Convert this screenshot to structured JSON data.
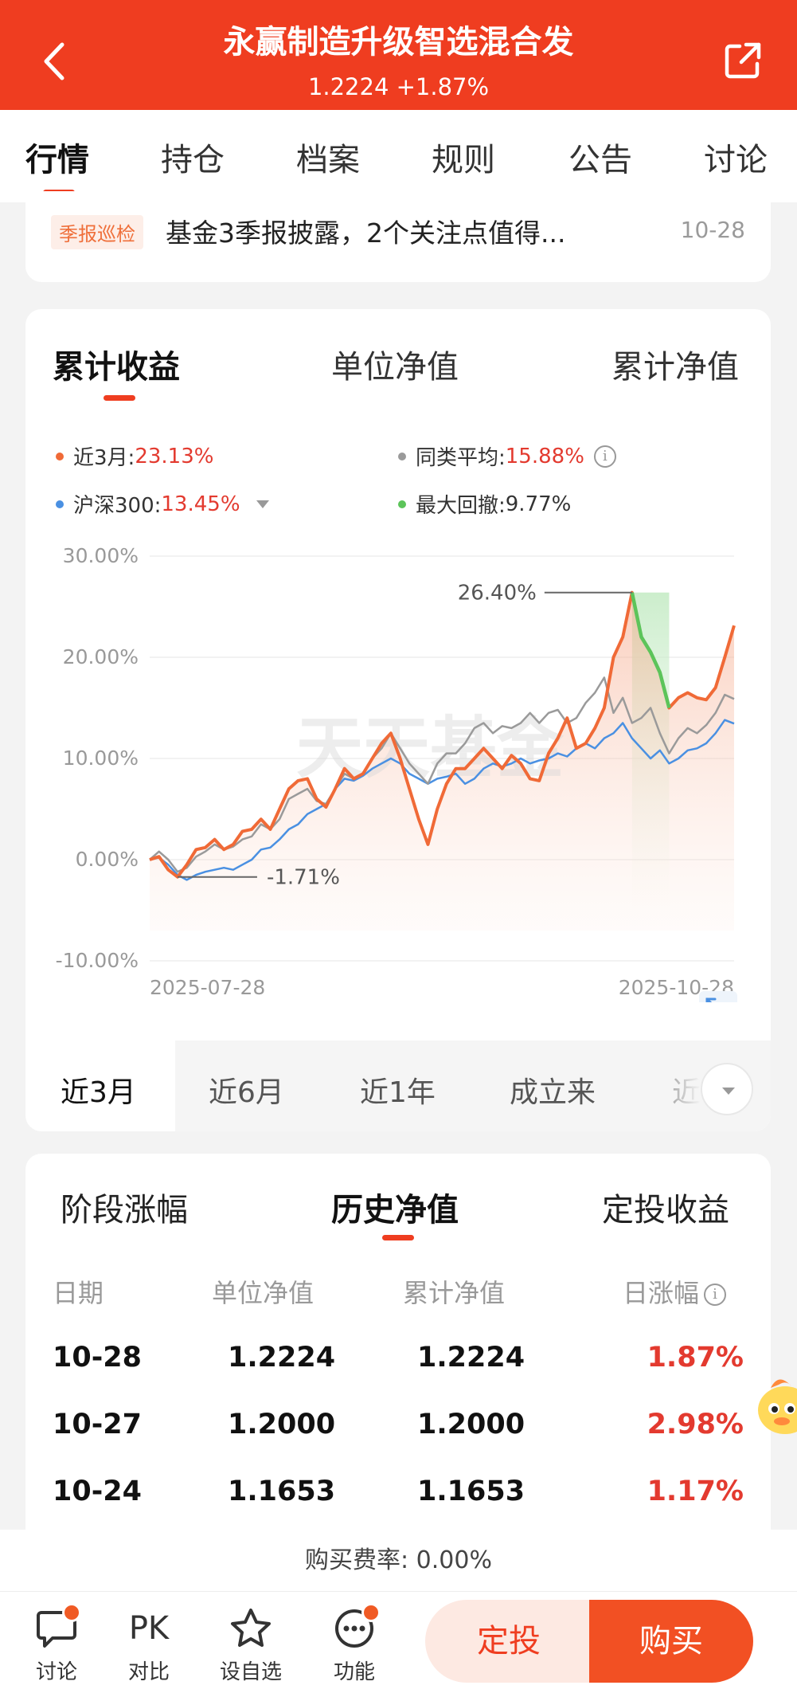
{
  "header": {
    "title": "永赢制造升级智选混合发",
    "nav_value": "1.2224 +1.87%"
  },
  "main_tabs": [
    "行情",
    "持仓",
    "档案",
    "规则",
    "公告",
    "讨论"
  ],
  "notice": {
    "tag": "季报巡检",
    "text": "基金3季报披露，2个关注点值得...",
    "date": "10-28"
  },
  "chart_tabs": [
    "累计收益",
    "单位净值",
    "累计净值"
  ],
  "legend": {
    "fund_label": "近3月:",
    "fund_value": "23.13%",
    "peer_label": "同类平均:",
    "peer_value": "15.88%",
    "index_label": "沪深300:",
    "index_value": "13.45%",
    "drawdown_label": "最大回撤:",
    "drawdown_value": "9.77%"
  },
  "watermark": "天天基金",
  "colors": {
    "accent": "#ef3d20",
    "fund": "#f06a37",
    "peer": "#9a9a9a",
    "index": "#4a90e2",
    "drawdown": "#5cc45a",
    "up": "#e33a2f"
  },
  "chart_data": {
    "type": "line",
    "ylim": [
      -10,
      30
    ],
    "yticks": [
      "30.00%",
      "20.00%",
      "10.00%",
      "0.00%",
      "-10.00%"
    ],
    "xticks": [
      "2025-07-28",
      "2025-10-28"
    ],
    "annotations": [
      "26.40%",
      "-1.71%"
    ],
    "series": [
      {
        "name": "近3月",
        "values": [
          0,
          0.3,
          -1,
          -1.71,
          -0.5,
          1,
          1.2,
          2,
          1,
          1.5,
          2.8,
          3,
          4,
          3,
          5,
          7,
          7.8,
          8,
          6,
          5.2,
          7,
          9,
          8,
          8.5,
          10,
          11.5,
          12.5,
          10,
          7,
          4,
          1.5,
          5,
          7.5,
          9,
          9,
          10,
          11,
          10,
          9,
          10.3,
          9.5,
          8,
          7.8,
          10.5,
          12,
          14,
          11,
          11.5,
          13,
          15,
          20,
          22,
          26.4,
          22,
          20.5,
          18.5,
          15,
          16,
          16.5,
          16,
          15.8,
          17,
          20,
          23.13
        ]
      },
      {
        "name": "同类平均",
        "values": [
          0,
          0.8,
          0,
          -1.2,
          -0.8,
          0.3,
          0.8,
          1.5,
          1,
          1.3,
          2,
          2.3,
          3.5,
          3,
          4,
          6,
          6.5,
          7,
          5.8,
          5.5,
          7,
          8.5,
          8,
          8.5,
          10,
          11,
          12.5,
          11,
          9.5,
          8.5,
          7.5,
          9.5,
          10.5,
          10.5,
          11.5,
          13,
          13.5,
          12.5,
          13.2,
          13,
          13.5,
          14.5,
          13.5,
          14.5,
          14.8,
          13.5,
          14,
          15.5,
          16.5,
          18,
          14.5,
          16,
          13.5,
          14,
          15,
          12.5,
          10.5,
          12,
          13,
          12.5,
          13.3,
          14.5,
          16.3,
          15.88
        ]
      },
      {
        "name": "沪深300",
        "values": [
          0,
          0.2,
          -0.5,
          -1.5,
          -2,
          -1.5,
          -1.2,
          -1,
          -0.8,
          -1,
          -0.5,
          0,
          1,
          1.2,
          2,
          3,
          3.5,
          4.5,
          5,
          5.5,
          7,
          8,
          7.8,
          8.3,
          9,
          9.5,
          10,
          9.5,
          8.5,
          8,
          7.5,
          8,
          8.2,
          8.5,
          7.5,
          8,
          9,
          9.5,
          9.2,
          9.5,
          10,
          9.5,
          9.8,
          10,
          10.5,
          10.2,
          11,
          11.5,
          11,
          12,
          12.5,
          13.5,
          12,
          11,
          10,
          10.8,
          9.5,
          10,
          10.8,
          11,
          11.5,
          12.5,
          13.8,
          13.45
        ]
      }
    ]
  },
  "periods": [
    "近3月",
    "近6月",
    "近1年",
    "成立来",
    "近"
  ],
  "history_tabs": [
    "阶段涨幅",
    "历史净值",
    "定投收益"
  ],
  "history_headers": [
    "日期",
    "单位净值",
    "累计净值",
    "日涨幅"
  ],
  "history_rows": [
    {
      "date": "10-28",
      "nav": "1.2224",
      "acc": "1.2224",
      "chg": "1.87%"
    },
    {
      "date": "10-27",
      "nav": "1.2000",
      "acc": "1.2000",
      "chg": "2.98%"
    },
    {
      "date": "10-24",
      "nav": "1.1653",
      "acc": "1.1653",
      "chg": "1.17%"
    }
  ],
  "fee": "购买费率: 0.00%",
  "bottom_bar": {
    "discuss": "讨论",
    "compare_icon_text": "PK",
    "compare": "对比",
    "watchlist": "设自选",
    "features": "功能",
    "dingtou": "定投",
    "buy": "购买"
  }
}
